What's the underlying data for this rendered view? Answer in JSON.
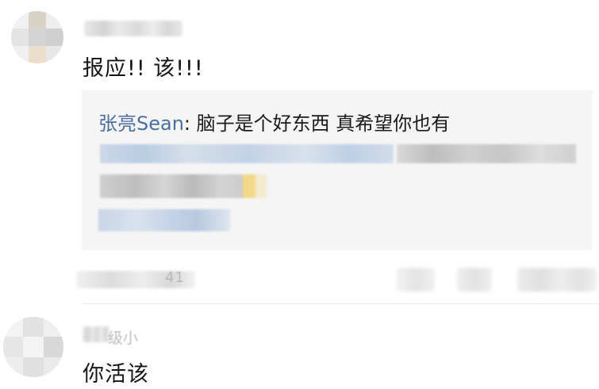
{
  "comments": [
    {
      "text": "报应!! 该!!!",
      "quote": {
        "author": "张亮Sean",
        "text": "脑子是个好东西 真希望你也有"
      },
      "meta_partial": "41"
    },
    {
      "username_partial": "级小",
      "text": "你活该"
    }
  ],
  "colors": {
    "quote_author": "#4a6f9e",
    "quote_background": "#f5f5f5"
  }
}
